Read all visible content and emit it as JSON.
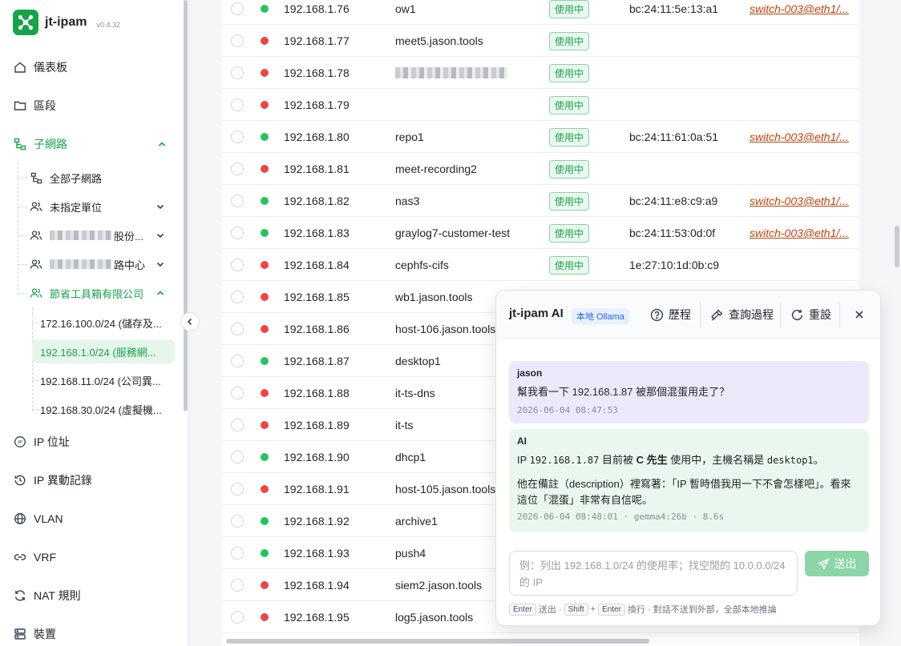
{
  "app": {
    "name": "jt-ipam",
    "version": "v0.4.32"
  },
  "colors": {
    "accent": "#16a34a",
    "status_on": "#22c55e",
    "status_off": "#ef4444",
    "switch_link": "#c2410c"
  },
  "sidebar": {
    "dashboard": "儀表板",
    "sections": "區段",
    "subnets": "子網路",
    "all_subnets": "全部子網路",
    "groups": [
      {
        "label": "未指定單位",
        "blurred": false
      },
      {
        "label": "股份...",
        "blurred": true
      },
      {
        "label": "路中心",
        "blurred": true
      },
      {
        "label": "節省工具箱有限公司",
        "blurred": false
      }
    ],
    "subnet_leaves": [
      {
        "label": "172.16.100.0/24 (儲存及..."
      },
      {
        "label": "192.168.1.0/24 (服務網..."
      },
      {
        "label": "192.168.11.0/24 (公司異..."
      },
      {
        "label": "192.168.30.0/24 (虛擬機..."
      }
    ],
    "ip_address": "IP 位址",
    "ip_history": "IP 異動記錄",
    "vlan": "VLAN",
    "vrf": "VRF",
    "nat": "NAT 規則",
    "devices": "裝置"
  },
  "table": {
    "rows": [
      {
        "ip": "192.168.1.76",
        "status": "on",
        "host": "ow1",
        "tag": "使用中",
        "mac": "bc:24:11:5e:13:a1",
        "switch": "switch-003@eth1/..."
      },
      {
        "ip": "192.168.1.77",
        "status": "off",
        "host": "meet5.jason.tools",
        "tag": "使用中",
        "mac": "",
        "switch": ""
      },
      {
        "ip": "192.168.1.78",
        "status": "off",
        "host": "",
        "host_blurred": true,
        "tag": "使用中",
        "mac": "",
        "switch": ""
      },
      {
        "ip": "192.168.1.79",
        "status": "off",
        "host": "",
        "tag": "使用中",
        "mac": "",
        "switch": ""
      },
      {
        "ip": "192.168.1.80",
        "status": "on",
        "host": "repo1",
        "tag": "使用中",
        "mac": "bc:24:11:61:0a:51",
        "switch": "switch-003@eth1/..."
      },
      {
        "ip": "192.168.1.81",
        "status": "off",
        "host": "meet-recording2",
        "tag": "使用中",
        "mac": "",
        "switch": ""
      },
      {
        "ip": "192.168.1.82",
        "status": "on",
        "host": "nas3",
        "tag": "使用中",
        "mac": "bc:24:11:e8:c9:a9",
        "switch": "switch-003@eth1/..."
      },
      {
        "ip": "192.168.1.83",
        "status": "on",
        "host": "graylog7-customer-test",
        "tag": "使用中",
        "mac": "bc:24:11:53:0d:0f",
        "switch": "switch-003@eth1/..."
      },
      {
        "ip": "192.168.1.84",
        "status": "off",
        "host": "cephfs-cifs",
        "tag": "使用中",
        "mac": "1e:27:10:1d:0b:c9",
        "switch": ""
      },
      {
        "ip": "192.168.1.85",
        "status": "off",
        "host": "wb1.jason.tools",
        "tag": "",
        "mac": "",
        "switch": ""
      },
      {
        "ip": "192.168.1.86",
        "status": "off",
        "host": "host-106.jason.tools",
        "tag": "",
        "mac": "",
        "switch": ""
      },
      {
        "ip": "192.168.1.87",
        "status": "on",
        "host": "desktop1",
        "tag": "",
        "mac": "",
        "switch": ""
      },
      {
        "ip": "192.168.1.88",
        "status": "off",
        "host": "it-ts-dns",
        "tag": "",
        "mac": "",
        "switch": ""
      },
      {
        "ip": "192.168.1.89",
        "status": "off",
        "host": "it-ts",
        "tag": "",
        "mac": "",
        "switch": ""
      },
      {
        "ip": "192.168.1.90",
        "status": "on",
        "host": "dhcp1",
        "tag": "",
        "mac": "",
        "switch": ""
      },
      {
        "ip": "192.168.1.91",
        "status": "off",
        "host": "host-105.jason.tools",
        "tag": "",
        "mac": "",
        "switch": ""
      },
      {
        "ip": "192.168.1.92",
        "status": "on",
        "host": "archive1",
        "tag": "",
        "mac": "",
        "switch": ""
      },
      {
        "ip": "192.168.1.93",
        "status": "on",
        "host": "push4",
        "tag": "",
        "mac": "",
        "switch": ""
      },
      {
        "ip": "192.168.1.94",
        "status": "off",
        "host": "siem2.jason.tools",
        "tag": "",
        "mac": "",
        "switch": ""
      },
      {
        "ip": "192.168.1.95",
        "status": "off",
        "host": "log5.jason.tools",
        "tag": "",
        "mac": "",
        "switch": ""
      }
    ]
  },
  "ai": {
    "title": "jt-ipam AI",
    "badge": "本地 Ollama",
    "history": "歷程",
    "query_process": "查詢過程",
    "reset": "重設",
    "user_msg": {
      "author": "jason",
      "text": "幫我看一下 192.168.1.87 被那個混蛋用走了？",
      "time": "2026-06-04 08:47:53"
    },
    "ai_msg": {
      "author": "AI",
      "p1_a": "IP ",
      "p1_ip": "192.168.1.87",
      "p1_b": " 目前被 ",
      "p1_user": "C 先生",
      "p1_c": " 使用中，主機名稱是 ",
      "p1_host": "desktop1",
      "p1_d": "。",
      "p2": "他在備註（description）裡寫著：「IP 暫時借我用一下不會怎樣吧」。看來這位「混蛋」非常有自信呢。",
      "meta": "2026-06-04 08:48:01 · gemma4:26b · 8.6s"
    },
    "placeholder": "例：列出 192.168.1.0/24 的使用率；找空閒的 10.0.0.0/24 的 IP",
    "send": "送出",
    "hint": {
      "enter": "Enter",
      "send_txt": "送出 ·",
      "shift": "Shift",
      "plus": "+",
      "enter2": "Enter",
      "rest": "換行 · 對話不送到外部，全部本地推論"
    }
  }
}
